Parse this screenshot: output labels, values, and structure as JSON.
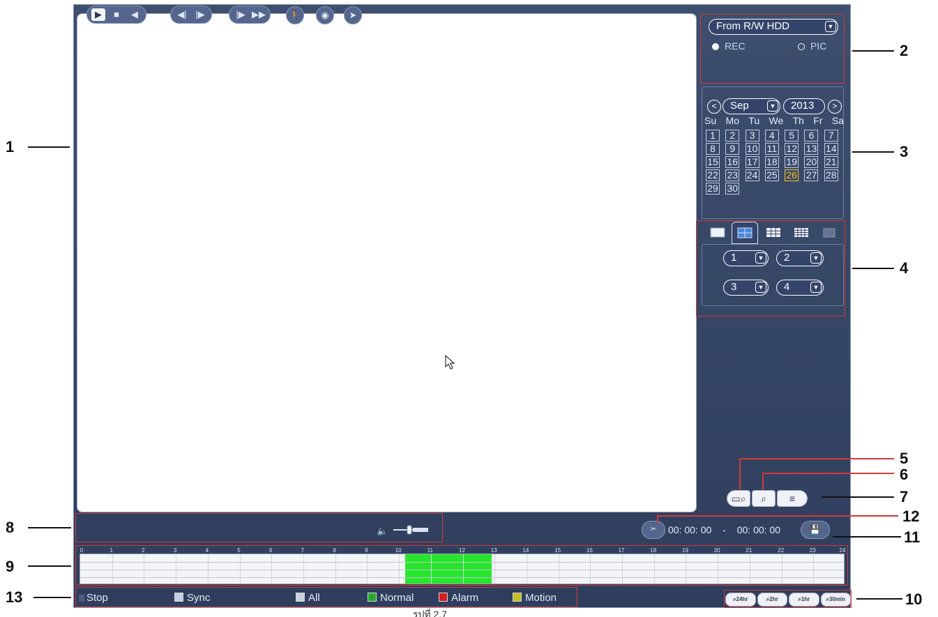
{
  "playback": {
    "source_select": "From R/W HDD",
    "type_options": {
      "rec": "REC",
      "pic": "PIC"
    }
  },
  "calendar": {
    "month": "Sep",
    "year": "2013",
    "weekdays": [
      "Su",
      "Mo",
      "Tu",
      "We",
      "Th",
      "Fr",
      "Sa"
    ],
    "days": [
      "1",
      "2",
      "3",
      "4",
      "5",
      "6",
      "7",
      "8",
      "9",
      "10",
      "11",
      "12",
      "13",
      "14",
      "15",
      "16",
      "17",
      "18",
      "19",
      "20",
      "21",
      "22",
      "23",
      "24",
      "25",
      "26",
      "27",
      "28",
      "29",
      "30"
    ],
    "highlighted_day": "26",
    "prev_icon": "chevron-left-icon",
    "next_icon": "chevron-right-icon"
  },
  "split_modes": [
    "single-window",
    "four-window",
    "nine-window",
    "sixteen-window",
    "full-window"
  ],
  "channels": [
    "1",
    "2",
    "3",
    "4"
  ],
  "side_buttons": {
    "search": "search-icon",
    "mark_search": "mark-search-icon",
    "file_list": "file-list-icon"
  },
  "controls": {
    "buttons": [
      "play-icon",
      "stop-icon",
      "backward-icon",
      "prev-frame-icon",
      "next-frame-icon",
      "slow-icon",
      "fast-icon",
      "smart-search-icon",
      "snapshot-icon",
      "mark-icon",
      "volume-icon"
    ],
    "clip_start": "00: 00: 00",
    "separator": "-",
    "clip_end": "00: 00: 00",
    "clip_icon": "clip-icon",
    "save_icon": "save-icon"
  },
  "timeline": {
    "hours": [
      "0",
      "1",
      "2",
      "3",
      "4",
      "5",
      "6",
      "7",
      "8",
      "9",
      "10",
      "11",
      "12",
      "13",
      "14",
      "15",
      "16",
      "17",
      "18",
      "19",
      "20",
      "21",
      "22",
      "23",
      "24"
    ],
    "record_start_hour": 10.2,
    "record_end_hour": 12.9,
    "record_color": "#26e62b"
  },
  "legend": {
    "stop": "Stop",
    "sync": "Sync",
    "all": "All",
    "normal": "Normal",
    "alarm": "Alarm",
    "motion": "Motion",
    "colors": {
      "normal": "#29a82e",
      "alarm": "#d81e1e",
      "motion": "#c6c020",
      "stop": "#4d5d80"
    }
  },
  "zoom": [
    "24hr",
    "2hr",
    "1hr",
    "30min"
  ],
  "callouts": [
    "1",
    "2",
    "3",
    "4",
    "5",
    "6",
    "7",
    "8",
    "9",
    "10",
    "11",
    "12",
    "13"
  ],
  "caption": "รูปที่ 2.7"
}
